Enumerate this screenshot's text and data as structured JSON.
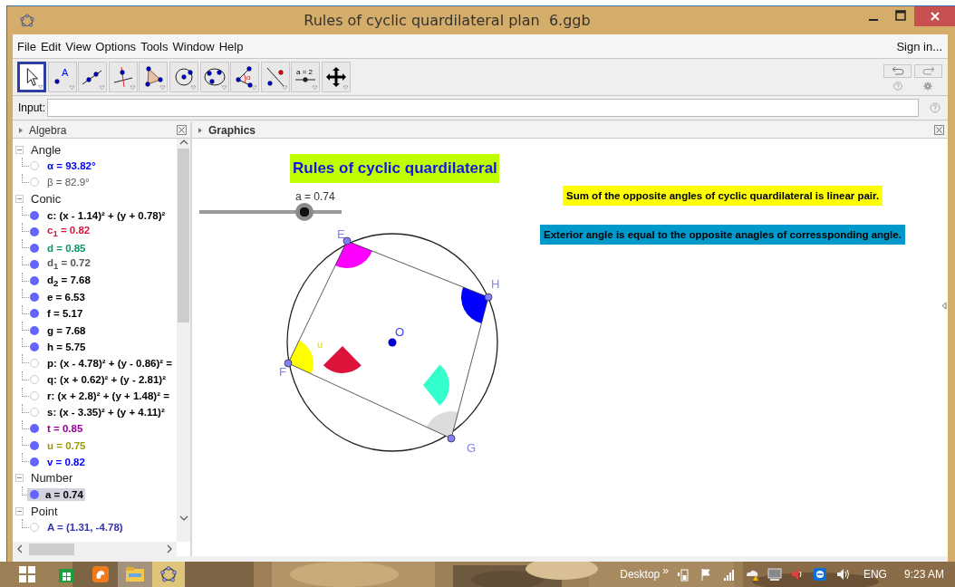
{
  "window": {
    "title": "Rules of cyclic quardilateral plan  6.ggb"
  },
  "menu": [
    "File",
    "Edit",
    "View",
    "Options",
    "Tools",
    "Window",
    "Help"
  ],
  "sign_in": "Sign in...",
  "toolbar": {
    "tools": [
      {
        "kind": "move",
        "selected": true
      },
      {
        "kind": "point",
        "selected": false,
        "label": "A"
      },
      {
        "kind": "line",
        "selected": false
      },
      {
        "kind": "perpendicular",
        "selected": false
      },
      {
        "kind": "polygon",
        "selected": false
      },
      {
        "kind": "circle",
        "selected": false
      },
      {
        "kind": "conic",
        "selected": false
      },
      {
        "kind": "angle",
        "selected": false,
        "label": "α"
      },
      {
        "kind": "reflect",
        "selected": false
      },
      {
        "kind": "slider",
        "selected": false,
        "label": "a = 2"
      },
      {
        "kind": "move-view",
        "selected": false
      }
    ]
  },
  "input": {
    "label": "Input:"
  },
  "algebra": {
    "title": "Algebra",
    "groups": [
      {
        "name": "Angle",
        "expanded": true,
        "items": [
          {
            "text": "α = 93.82°",
            "color": "#0000ff",
            "bold": true,
            "visible": false,
            "selected": false
          },
          {
            "text": "β = 82.9°",
            "color": "#555555",
            "bold": false,
            "visible": false,
            "selected": false
          }
        ]
      },
      {
        "name": "Conic",
        "expanded": true,
        "items": [
          {
            "text": "c: (x - 1.14)² + (y + 0.78)²",
            "color": "#000000",
            "bold": true,
            "visible": true,
            "selected": false
          },
          {
            "text": "c$_{1}$ = 0.82",
            "color": "#dc143c",
            "bold": true,
            "visible": true,
            "selected": false
          },
          {
            "text": "d = 0.85",
            "color": "#009966",
            "bold": true,
            "visible": true,
            "selected": false
          },
          {
            "text": "d$_{1}$ = 0.72",
            "color": "#555555",
            "bold": true,
            "visible": true,
            "selected": false
          },
          {
            "text": "d$_{2}$ = 7.68",
            "color": "#000000",
            "bold": true,
            "visible": true,
            "selected": false
          },
          {
            "text": "e = 6.53",
            "color": "#000000",
            "bold": true,
            "visible": true,
            "selected": false
          },
          {
            "text": "f = 5.17",
            "color": "#000000",
            "bold": true,
            "visible": true,
            "selected": false
          },
          {
            "text": "g = 7.68",
            "color": "#000000",
            "bold": true,
            "visible": true,
            "selected": false
          },
          {
            "text": "h = 5.75",
            "color": "#000000",
            "bold": true,
            "visible": true,
            "selected": false
          },
          {
            "text": "p: (x - 4.78)² + (y - 0.86)² =",
            "color": "#000000",
            "bold": true,
            "visible": false,
            "selected": false
          },
          {
            "text": "q: (x + 0.62)² + (y - 2.81)²",
            "color": "#000000",
            "bold": true,
            "visible": false,
            "selected": false
          },
          {
            "text": "r: (x + 2.8)² + (y + 1.48)² =",
            "color": "#000000",
            "bold": true,
            "visible": false,
            "selected": false
          },
          {
            "text": "s: (x - 3.35)² + (y + 4.11)²",
            "color": "#000000",
            "bold": true,
            "visible": false,
            "selected": false
          },
          {
            "text": "t = 0.85",
            "color": "#990099",
            "bold": true,
            "visible": true,
            "selected": false
          },
          {
            "text": "u = 0.75",
            "color": "#999900",
            "bold": true,
            "visible": true,
            "selected": false
          },
          {
            "text": "v = 0.82",
            "color": "#0000ff",
            "bold": true,
            "visible": true,
            "selected": false
          }
        ]
      },
      {
        "name": "Number",
        "expanded": true,
        "items": [
          {
            "text": "a = 0.74",
            "color": "#000000",
            "bold": true,
            "visible": true,
            "selected": true
          }
        ]
      },
      {
        "name": "Point",
        "expanded": true,
        "items": [
          {
            "text": "A = (1.31, -4.78)",
            "color": "#3333aa",
            "bold": true,
            "visible": false,
            "selected": false
          }
        ]
      }
    ]
  },
  "graphics": {
    "title": "Graphics",
    "heading": "Rules of cyclic quardilateral",
    "slider": {
      "label": "a = 0.74",
      "level": 0.74
    },
    "notes": [
      {
        "text": "Sum of the opposite angles of cyclic quardilateral is linear pair.",
        "color": "#ffff00"
      },
      {
        "text": "Exterior angle is equal to the opposite anagles of corressponding angle.",
        "color": "#0099cc"
      }
    ],
    "points": [
      {
        "label": "E"
      },
      {
        "label": "H"
      },
      {
        "label": "G"
      },
      {
        "label": "F"
      },
      {
        "label": "O"
      }
    ],
    "angle_label": "u"
  },
  "taskbar": {
    "desktop": "Desktop",
    "more": "»",
    "language": "ENG",
    "time": "9:23 AM"
  }
}
